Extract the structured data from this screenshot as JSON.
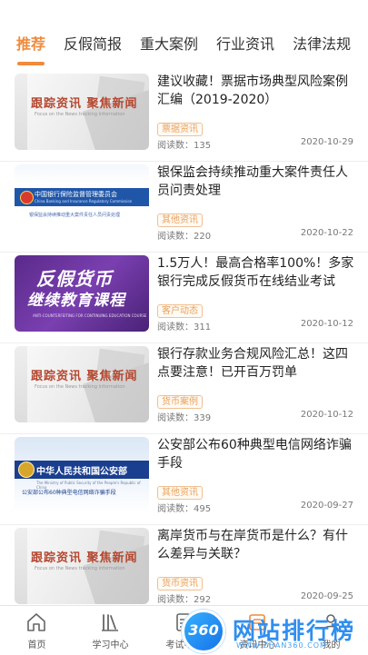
{
  "tabs": [
    {
      "label": "推荐",
      "active": true
    },
    {
      "label": "反假简报",
      "active": false
    },
    {
      "label": "重大案例",
      "active": false
    },
    {
      "label": "行业资讯",
      "active": false
    },
    {
      "label": "法律法规",
      "active": false
    }
  ],
  "accent_color": "#f08a3c",
  "articles": [
    {
      "title": "建议收藏！票据市场典型风险案例汇编（2019-2020）",
      "tag": "票据资讯",
      "reads": "阅读数：135",
      "date": "2020-10-29",
      "thumb": {
        "headline": "跟踪资讯  聚焦新闻",
        "subline": "Focus on the News tracking information"
      }
    },
    {
      "title": "银保监会持续推动重大案件责任人员问责处理",
      "tag": "其他资讯",
      "reads": "阅读数：220",
      "date": "2020-10-22",
      "thumb": {
        "name": "中国银行保险监督管理委员会",
        "en": "China Banking and Insurance Regulatory Commission",
        "line": "银保监会持续推动重大案件责任人员问责处理"
      }
    },
    {
      "title": "1.5万人！最高合格率100%！多家银行完成反假货币在线结业考试",
      "tag": "客户动态",
      "reads": "阅读数：311",
      "date": "2020-10-12",
      "thumb": {
        "line1": "反假货币",
        "line2": "继续教育课程",
        "en": "ANTI-COUNTERFEITING FOR CONTINUING EDUCATION COURSE"
      }
    },
    {
      "title": "银行存款业务合规风险汇总！这四点要注意！已开百万罚单",
      "tag": "货币案例",
      "reads": "阅读数：339",
      "date": "2020-10-12",
      "thumb": {
        "headline": "跟踪资讯  聚焦新闻",
        "subline": "Focus on the News tracking information"
      }
    },
    {
      "title": "公安部公布60种典型电信网络诈骗手段",
      "tag": "其他资讯",
      "reads": "阅读数：495",
      "date": "2020-09-27",
      "thumb": {
        "name": "中华人民共和国公安部",
        "en": "The Ministry of Public Security of the People's Republic of China",
        "line": "公安部公布60种典型电信网络诈骗手段"
      }
    },
    {
      "title": "离岸货币与在岸货币是什么？有什么差异与关联？",
      "tag": "货币资讯",
      "reads": "阅读数：292",
      "date": "2020-09-25",
      "thumb": {
        "headline": "跟踪资讯  聚焦新闻",
        "subline": "Focus on the News tracking information"
      }
    }
  ],
  "nav": [
    {
      "label": "首页",
      "icon": "home-icon"
    },
    {
      "label": "学习中心",
      "icon": "books-icon"
    },
    {
      "label": "考试中心",
      "icon": "exam-icon"
    },
    {
      "label": "资讯中心",
      "icon": "news-icon"
    },
    {
      "label": "我的",
      "icon": "user-icon"
    }
  ],
  "watermark": {
    "number": "360",
    "text": "网站排行榜",
    "url": "WWW.ZHAN360.COM"
  }
}
